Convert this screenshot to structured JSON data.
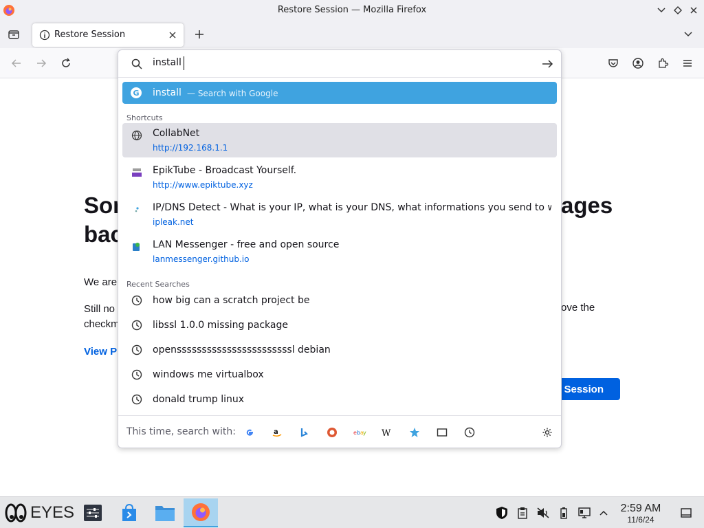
{
  "window": {
    "title": "Restore Session — Mozilla Firefox"
  },
  "tabs": [
    {
      "label": "Restore Session"
    }
  ],
  "urlbar": {
    "value": "install",
    "suggestion": {
      "text": "install",
      "action": "— Search with Google"
    },
    "shortcuts_label": "Shortcuts",
    "shortcuts": [
      {
        "title": "CollabNet",
        "url": "http://192.168.1.1",
        "icon": "globe-icon"
      },
      {
        "title": "EpikTube - Broadcast Yourself.",
        "url": "http://www.epiktube.xyz",
        "icon": "epiktube-icon"
      },
      {
        "title": "IP/DNS Detect - What is your IP, what is your DNS, what informations you send to websit",
        "url": "ipleak.net",
        "icon": "ipleak-icon"
      },
      {
        "title": "LAN Messenger - free and open source",
        "url": "lanmessenger.github.io",
        "icon": "lan-messenger-icon"
      }
    ],
    "recent_label": "Recent Searches",
    "recent": [
      "how big can a scratch project be",
      "libssl 1.0.0 missing package",
      "opensssssssssssssssssssssssl debian",
      "windows me virtualbox",
      "donald trump linux"
    ],
    "footer_label": "This time, search with:"
  },
  "page": {
    "heading_line1_start": "Sor",
    "heading_line1_end": "ages",
    "heading_line2": "bac",
    "para1": "We are",
    "para2_line1": "Still no",
    "para2_line2": "checkm",
    "para2_right": "ove the",
    "view_link": "View P",
    "restore_button": "Session"
  },
  "taskbar": {
    "brand": "EYES",
    "time": "2:59 AM",
    "date": "11/6/24"
  },
  "colors": {
    "accent": "#0061e0",
    "highlight": "#3fa3e0"
  }
}
